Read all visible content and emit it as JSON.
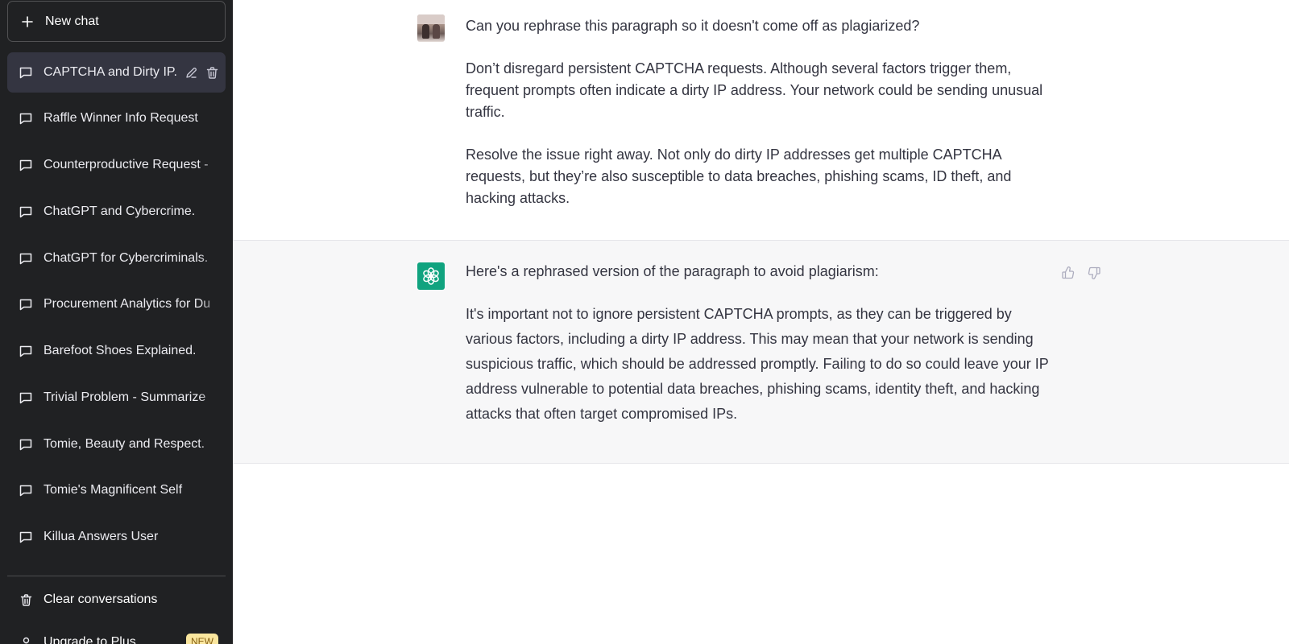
{
  "sidebar": {
    "new_chat_label": "New chat",
    "conversations": [
      {
        "label": "CAPTCHA and Dirty IP.",
        "active": true
      },
      {
        "label": "Raffle Winner Info Request"
      },
      {
        "label": "Counterproductive Request -"
      },
      {
        "label": "ChatGPT and Cybercrime."
      },
      {
        "label": "ChatGPT for Cybercriminals."
      },
      {
        "label": "Procurement Analytics for Du"
      },
      {
        "label": "Barefoot Shoes Explained."
      },
      {
        "label": "Trivial Problem - Summarize"
      },
      {
        "label": "Tomie, Beauty and Respect."
      },
      {
        "label": "Tomie's Magnificent Self"
      },
      {
        "label": "Killua Answers User"
      }
    ],
    "clear_label": "Clear conversations",
    "upgrade_label": "Upgrade to Plus",
    "upgrade_badge": "NEW"
  },
  "thread": {
    "user": {
      "p1": "Can you rephrase this paragraph so it doesn't come off as plagiarized?",
      "p2": "Don’t disregard persistent CAPTCHA requests. Although several factors trigger them, frequent prompts often indicate a dirty IP address. Your network could be sending unusual traffic.",
      "p3": "Resolve the issue right away. Not only do dirty IP addresses get multiple CAPTCHA requests, but they’re also susceptible to data breaches, phishing scams, ID theft, and hacking attacks."
    },
    "assistant": {
      "p1": "Here's a rephrased version of the paragraph to avoid plagiarism:",
      "p2": "It's important not to ignore persistent CAPTCHA prompts, as they can be triggered by various factors, including a dirty IP address. This may mean that your network is sending suspicious traffic, which should be addressed promptly. Failing to do so could leave your IP address vulnerable to potential data breaches, phishing scams, identity theft, and hacking attacks that often target compromised IPs."
    }
  },
  "colors": {
    "sidebar_bg": "#202123",
    "active_item_bg": "#343541",
    "assistant_bg": "#f7f7f8",
    "gpt_brand": "#10a37f",
    "badge_bg": "#fae69e"
  }
}
